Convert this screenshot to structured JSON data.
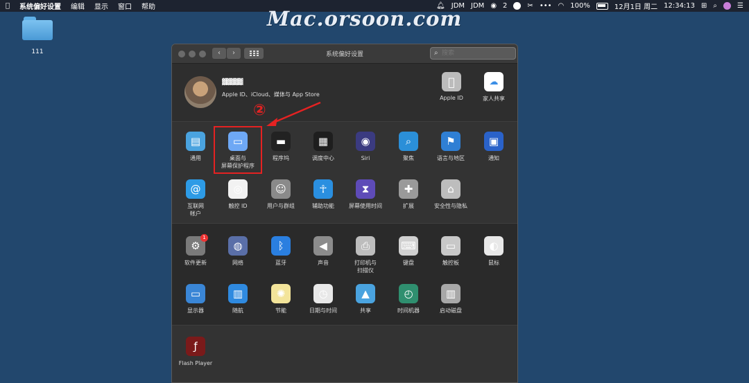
{
  "menubar": {
    "app_name": "系统偏好设置",
    "menus": [
      "编辑",
      "显示",
      "窗口",
      "帮助"
    ],
    "status": {
      "jdm1": "JDM",
      "jdm2": "JDM",
      "wechat_count": "2",
      "battery": "100%",
      "date": "12月1日 周二",
      "time": "12:34:13"
    }
  },
  "desktop": {
    "folder_label": "111",
    "watermark": "Mac.orsoon.com"
  },
  "window": {
    "title": "系统偏好设置",
    "search_placeholder": "搜索"
  },
  "account": {
    "name": "▓▓▓▓▓",
    "subtitle": "Apple ID、iCloud、媒体与 App Store",
    "items": [
      {
        "label": "Apple ID",
        "icon": "apple-icon"
      },
      {
        "label": "家人共享",
        "icon": "family-sharing-icon"
      }
    ]
  },
  "annotation": {
    "step": "②"
  },
  "panes_section1": [
    {
      "label": "通用",
      "icon": "general-icon",
      "color": "#4aa3df"
    },
    {
      "label": "桌面与\n屏幕保护程序",
      "icon": "desktop-screensaver-icon",
      "color": "#6ea8f5"
    },
    {
      "label": "程序坞",
      "icon": "dock-icon",
      "color": "#222222"
    },
    {
      "label": "调度中心",
      "icon": "mission-control-icon",
      "color": "#1e1e1e"
    },
    {
      "label": "Siri",
      "icon": "siri-icon",
      "color": "#3b3b80"
    },
    {
      "label": "聚焦",
      "icon": "spotlight-icon",
      "color": "#2b8fd8"
    },
    {
      "label": "语言与地区",
      "icon": "language-region-icon",
      "color": "#2f7fd4"
    },
    {
      "label": "通知",
      "icon": "notifications-icon",
      "color": "#2a62c9"
    },
    {
      "label": "互联网\n帐户",
      "icon": "internet-accounts-icon",
      "color": "#2d9be6"
    },
    {
      "label": "触控 ID",
      "icon": "touch-id-icon",
      "color": "#f2f2f2"
    },
    {
      "label": "用户与群组",
      "icon": "users-groups-icon",
      "color": "#8a8a8a"
    },
    {
      "label": "辅助功能",
      "icon": "accessibility-icon",
      "color": "#2a8fe0"
    },
    {
      "label": "屏幕使用时间",
      "icon": "screen-time-icon",
      "color": "#5e4bb8"
    },
    {
      "label": "扩展",
      "icon": "extensions-icon",
      "color": "#9a9a9a"
    },
    {
      "label": "安全性与隐私",
      "icon": "security-privacy-icon",
      "color": "#bdbdbd"
    }
  ],
  "panes_section2": [
    {
      "label": "软件更新",
      "icon": "software-update-icon",
      "color": "#7a7a7a",
      "badge": "1"
    },
    {
      "label": "网络",
      "icon": "network-icon",
      "color": "#5a6fa8"
    },
    {
      "label": "蓝牙",
      "icon": "bluetooth-icon",
      "color": "#2a7fe0"
    },
    {
      "label": "声音",
      "icon": "sound-icon",
      "color": "#8c8c8c"
    },
    {
      "label": "打印机与\n扫描仪",
      "icon": "printers-scanners-icon",
      "color": "#bdbdbd"
    },
    {
      "label": "键盘",
      "icon": "keyboard-icon",
      "color": "#d0d0d0"
    },
    {
      "label": "触控板",
      "icon": "trackpad-icon",
      "color": "#c8c8c8"
    },
    {
      "label": "鼠标",
      "icon": "mouse-icon",
      "color": "#e8e8e8"
    },
    {
      "label": "显示器",
      "icon": "displays-icon",
      "color": "#3a86d6"
    },
    {
      "label": "随航",
      "icon": "sidecar-icon",
      "color": "#2f8ae0"
    },
    {
      "label": "节能",
      "icon": "energy-saver-icon",
      "color": "#f3e49a"
    },
    {
      "label": "日期与时间",
      "icon": "date-time-icon",
      "color": "#e8e8e8"
    },
    {
      "label": "共享",
      "icon": "sharing-icon",
      "color": "#4aa3df"
    },
    {
      "label": "时间机器",
      "icon": "time-machine-icon",
      "color": "#2f8f6f"
    },
    {
      "label": "启动磁盘",
      "icon": "startup-disk-icon",
      "color": "#a8a8a8"
    }
  ],
  "panes_section3": [
    {
      "label": "Flash Player",
      "icon": "flash-player-icon",
      "color": "#7a1a1a"
    }
  ]
}
